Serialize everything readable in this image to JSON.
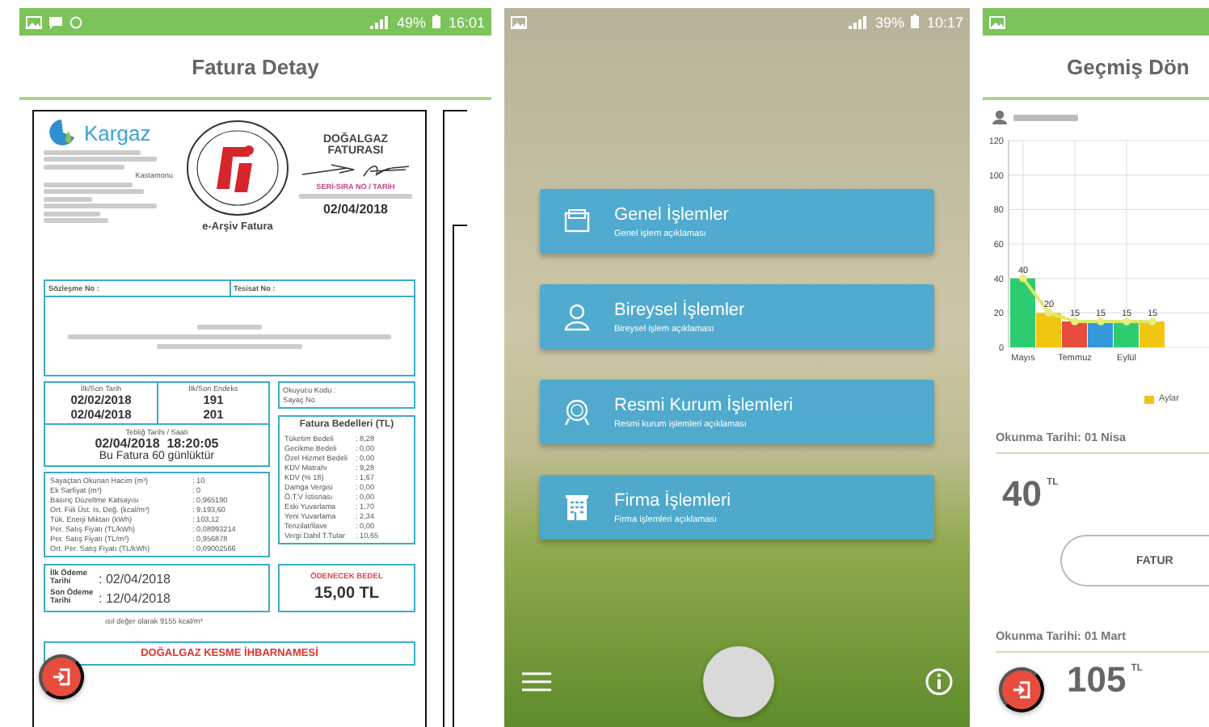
{
  "invoice_screen": {
    "status_bar": {
      "battery": "49%",
      "time": "16:01"
    },
    "title": "Fatura Detay",
    "document": {
      "company": "Kargaz",
      "city": "Kastamonu",
      "seal_caption": "e-Arşiv Fatura",
      "doc_title": "DOĞALGAZ FATURASI",
      "serial_label": "SERİ-SIRA NO / TARİH",
      "date": "02/04/2018",
      "contract_label": "Sözleşme No :",
      "facility_label": "Tesisat No :",
      "dates_label": "İlk/Son Tarih",
      "dates": [
        "02/02/2018",
        "02/04/2018"
      ],
      "index_label": "İlk/Son Endeks",
      "indexes": [
        "191",
        "201"
      ],
      "notice_label": "Tebliğ Tarihi / Saati",
      "notice_time": "02/04/2018  18:20:05",
      "period_note": "Bu Fatura 60 günlüktür",
      "reader_labels": [
        "Okuyucu Kodu :",
        "Sayaç No"
      ],
      "readings": [
        {
          "label": "Sayaçtan Okunan Hacim (m³)",
          "value": ": 10"
        },
        {
          "label": "Ek Sarfiyat (m³)",
          "value": ": 0"
        },
        {
          "label": "Basınç Düzeltme Katsayısı",
          "value": ": 0,965190"
        },
        {
          "label": "Ort. Fiili Üst. Is. Değ. (kcal/m³)",
          "value": ": 9.193,60"
        },
        {
          "label": "Tük. Enerji Miktarı (kWh)",
          "value": ": 103,12"
        },
        {
          "label": "Per. Satış Fiyatı (TL/kWh)",
          "value": ": 0,08993214"
        },
        {
          "label": "Per. Satış Fiyatı (TL/m³)",
          "value": ": 0,956878"
        },
        {
          "label": "Ort. Per. Satış Fiyatı (TL/kWh)",
          "value": ": 0,09002566"
        }
      ],
      "charges_title": "Fatura Bedelleri (TL)",
      "charges": [
        {
          "label": "Tüketim Bedeli",
          "value": ": 8,28"
        },
        {
          "label": "Gecikme Bedeli",
          "value": ": 0,00"
        },
        {
          "label": "Özel Hizmet Bedeli",
          "value": ": 0,00"
        },
        {
          "label": "KDV Matrahı",
          "value": ": 9,28"
        },
        {
          "label": "KDV (% 18)",
          "value": ": 1,67"
        },
        {
          "label": "Damga Vergisi",
          "value": ": 0,00"
        },
        {
          "label": "Ö.T.V İstisnası",
          "value": ": 0,00"
        },
        {
          "label": "Eski Yuvarlama",
          "value": ": 1,70"
        },
        {
          "label": "Yeni Yuvarlama",
          "value": ": 2,34"
        },
        {
          "label": "Tenzilat/İlave",
          "value": ": 0,00"
        },
        {
          "label": "Vergi Dahil T.Tutar",
          "value": ": 10,65"
        }
      ],
      "payment": [
        {
          "label": "İlk Ödeme Tarihi",
          "value": ": 02/04/2018"
        },
        {
          "label": "Son Ödeme Tarihi",
          "value": ": 12/04/2018"
        }
      ],
      "due_label": "ÖDENECEK BEDEL",
      "due_amount": "15,00 TL",
      "note": "ısıl değer olarak 9155 kcal/m³",
      "cutoff_title": "DOĞALGAZ KESME İHBARNAMESİ"
    }
  },
  "menu_screen": {
    "status_bar": {
      "battery": "39%",
      "time": "10:17"
    },
    "items": [
      {
        "kind": "general",
        "title": "Genel İşlemler",
        "description": "Genel işlem açıklaması"
      },
      {
        "kind": "personal",
        "title": "Bireysel İşlemler",
        "description": "Bireysel işlem açıklaması"
      },
      {
        "kind": "institution",
        "title": "Resmi Kurum İşlemleri",
        "description": "Resmi kurum işlemleri açıklaması"
      },
      {
        "kind": "company",
        "title": "Firma İşlemleri",
        "description": "Firma işlemleri açıklaması"
      }
    ]
  },
  "history_screen": {
    "title": "Geçmiş Dön",
    "chart_data": {
      "type": "bar",
      "categories": [
        "Mayıs",
        null,
        "Temmuz",
        null,
        "Eylül",
        null
      ],
      "ylim": [
        0,
        120
      ],
      "yticks": [
        0,
        20,
        40,
        60,
        80,
        100,
        120
      ],
      "data_labels": true,
      "stacked": true,
      "grid": true,
      "series": [
        {
          "color": "#2ecc71",
          "values": [
            40,
            null,
            null,
            null,
            15,
            null
          ]
        },
        {
          "name": "Aylar",
          "color": "#f2c511",
          "values": [
            null,
            20,
            null,
            null,
            null,
            15
          ]
        },
        {
          "color": "#e74c3c",
          "values": [
            null,
            null,
            15,
            null,
            null,
            null
          ]
        },
        {
          "color": "#3498db",
          "values": [
            null,
            null,
            null,
            15,
            null,
            null
          ]
        }
      ]
    },
    "records": [
      {
        "date": "Okunma Tarihi: 01 Nisa",
        "amount": "40",
        "currency": "TL",
        "button": "FATUR"
      },
      {
        "date": "Okunma Tarihi: 01 Mart",
        "amount": "105",
        "currency": "TL"
      }
    ]
  }
}
